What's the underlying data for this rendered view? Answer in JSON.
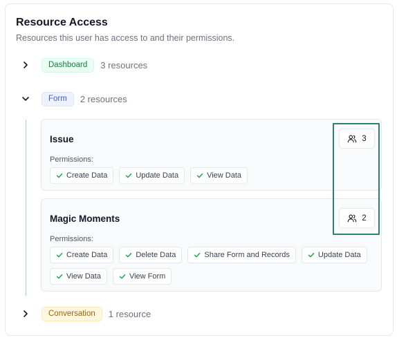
{
  "header": {
    "title": "Resource Access",
    "subtitle": "Resources this user has access to and their permissions."
  },
  "groups": [
    {
      "badge": "Dashboard",
      "count": "3 resources",
      "expanded": false,
      "badge_color": "#15803d"
    },
    {
      "badge": "Form",
      "count": "2 resources",
      "expanded": true,
      "badge_color": "#3b5bdb",
      "resources": [
        {
          "name": "Issue",
          "permissions_label": "Permissions:",
          "user_count": "3",
          "permissions": [
            "Create Data",
            "Update Data",
            "View Data"
          ]
        },
        {
          "name": "Magic Moments",
          "permissions_label": "Permissions:",
          "user_count": "2",
          "permissions": [
            "Create Data",
            "Delete Data",
            "Share Form and Records",
            "Update Data",
            "View Data",
            "View Form"
          ]
        }
      ]
    },
    {
      "badge": "Conversation",
      "count": "1 resource",
      "expanded": false,
      "badge_color": "#a16207"
    }
  ],
  "icons": {
    "collapsed": "chevron-right-icon",
    "expanded": "chevron-down-icon",
    "permission": "check-icon",
    "users": "users-icon"
  },
  "colors": {
    "highlight_border": "#2f7f6f",
    "check": "#16a34a"
  }
}
